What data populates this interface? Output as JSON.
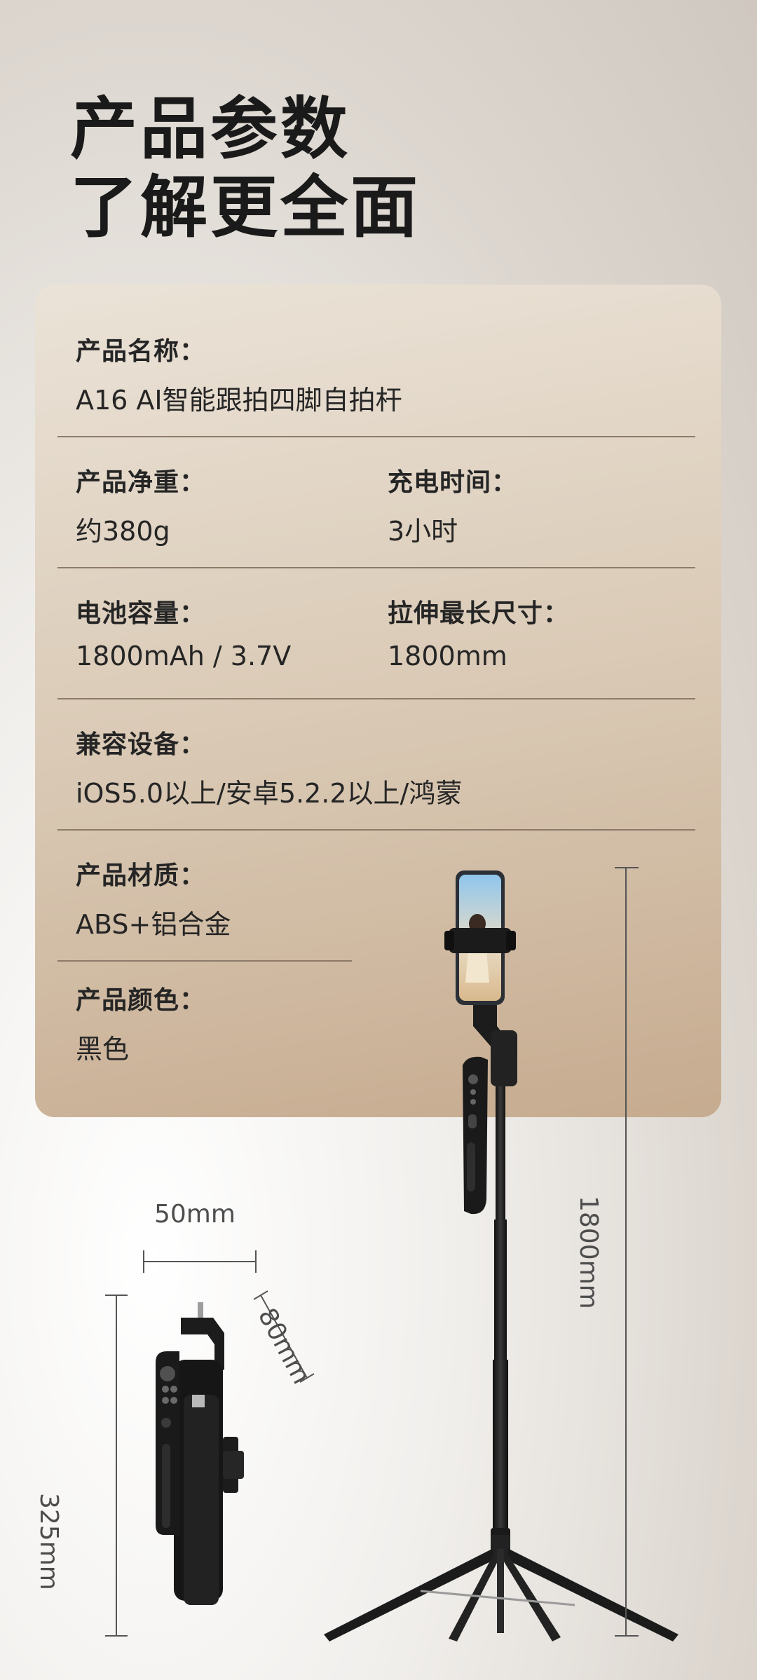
{
  "heading": {
    "line1": "产品参数",
    "line2": "了解更全面"
  },
  "specs": {
    "name": {
      "label": "产品名称：",
      "value": "A16 AI智能跟拍四脚自拍杆"
    },
    "weight": {
      "label": "产品净重：",
      "value": "约380g"
    },
    "charge_time": {
      "label": "充电时间：",
      "value": "3小时"
    },
    "battery": {
      "label": "电池容量：",
      "value": "1800mAh / 3.7V"
    },
    "max_length": {
      "label": "拉伸最长尺寸：",
      "value": "1800mm"
    },
    "compat": {
      "label": "兼容设备：",
      "value": "iOS5.0以上/安卓5.2.2以上/鸿蒙"
    },
    "material": {
      "label": "产品材质：",
      "value": "ABS+铝合金"
    },
    "color": {
      "label": "产品颜色：",
      "value": "黑色"
    }
  },
  "dimensions": {
    "width": "50mm",
    "depth": "80mm",
    "folded_height": "325mm",
    "extended_height": "1800mm"
  },
  "colors": {
    "accent": "#c6ab8f",
    "text": "#252525"
  }
}
